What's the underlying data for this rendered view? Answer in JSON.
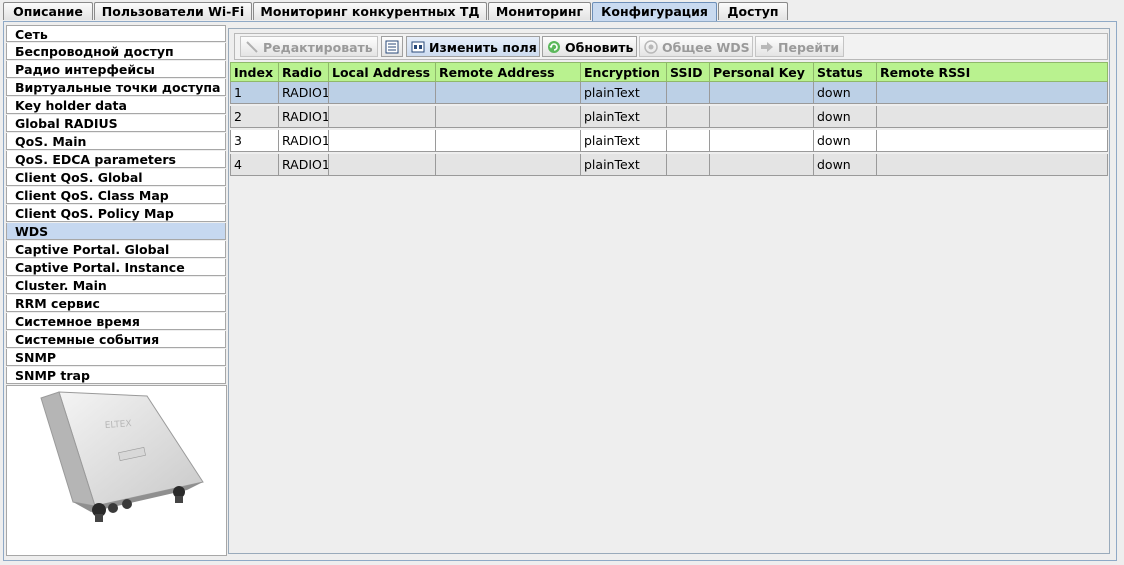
{
  "tabs": [
    {
      "label": "Описание"
    },
    {
      "label": "Пользователи Wi-Fi"
    },
    {
      "label": "Мониторинг конкурентных ТД"
    },
    {
      "label": "Мониторинг"
    },
    {
      "label": "Конфигурация",
      "active": true
    },
    {
      "label": "Доступ"
    }
  ],
  "sidebar": {
    "items": [
      {
        "label": "Сеть"
      },
      {
        "label": "Беспроводной доступ"
      },
      {
        "label": "Радио интерфейсы"
      },
      {
        "label": "Виртуальные точки доступа"
      },
      {
        "label": "Key holder data"
      },
      {
        "label": "Global RADIUS"
      },
      {
        "label": "QoS. Main"
      },
      {
        "label": "QoS. EDCA parameters"
      },
      {
        "label": "Client QoS. Global"
      },
      {
        "label": "Client QoS. Class Map"
      },
      {
        "label": "Client QoS. Policy Map"
      },
      {
        "label": "WDS",
        "active": true
      },
      {
        "label": "Captive Portal. Global"
      },
      {
        "label": "Captive Portal. Instance"
      },
      {
        "label": "Cluster. Main"
      },
      {
        "label": "RRM сервис"
      },
      {
        "label": "Системное время"
      },
      {
        "label": "Системные события"
      },
      {
        "label": "SNMP"
      },
      {
        "label": "SNMP trap"
      }
    ],
    "device_brand": "ELTEX"
  },
  "toolbar": {
    "edit_label": "Редактировать",
    "change_fields_label": "Изменить поля",
    "refresh_label": "Обновить",
    "global_wds_label": "Общее WDS",
    "goto_label": "Перейти"
  },
  "table": {
    "columns": [
      "Index",
      "Radio",
      "Local Address",
      "Remote Address",
      "Encryption",
      "SSID",
      "Personal Key",
      "Status",
      "Remote RSSI"
    ],
    "rows": [
      [
        "1",
        "RADIO1",
        "",
        "",
        "plainText",
        "",
        "",
        "down",
        ""
      ],
      [
        "2",
        "RADIO1",
        "",
        "",
        "plainText",
        "",
        "",
        "down",
        ""
      ],
      [
        "3",
        "RADIO1",
        "",
        "",
        "plainText",
        "",
        "",
        "down",
        ""
      ],
      [
        "4",
        "RADIO1",
        "",
        "",
        "plainText",
        "",
        "",
        "down",
        ""
      ]
    ],
    "selected_row": 0
  },
  "colors": {
    "header_bg": "#b9f28f",
    "selected_bg": "#bcd0e6",
    "active_tab_bg": "#c9daf0"
  }
}
